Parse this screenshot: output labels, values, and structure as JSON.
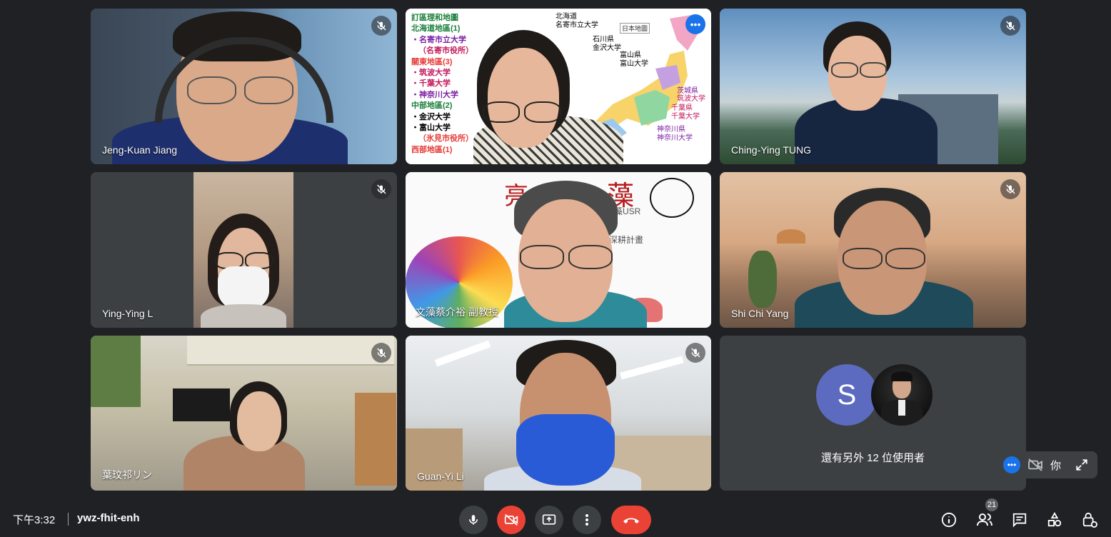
{
  "participants": [
    {
      "name": "Jeng-Kuan Jiang"
    },
    {
      "name": "Ching-Ying TUNG"
    },
    {
      "name": "Ying-Ying L"
    },
    {
      "name": "Shi Chi Yang"
    },
    {
      "name": "葉玟祁リン"
    },
    {
      "name": "Guan-Yi Li"
    }
  ],
  "map_slide": {
    "title": "訂區理和地圖",
    "lines": [
      "北海道地區(1)",
      "・名寄市立大学",
      "（名寄市役所）",
      "關東地區(3)",
      "・筑波大学",
      "・千葉大学",
      "・神奈川大学",
      "中部地區(2)",
      "・金沢大学",
      "・富山大学",
      "（氷見市役所）",
      "西部地區(1)"
    ],
    "map_labels": [
      "北海道",
      "名寄市立大学",
      "石川県",
      "金沢大学",
      "富山県",
      "富山大学",
      "茨城県",
      "筑波大学",
      "千葉県",
      "千葉大学",
      "神奈川県",
      "神奈川大学"
    ],
    "legend": "日本地圖"
  },
  "usr_slide": {
    "char_a": "藻",
    "char_b": "亮",
    "subtitle": "文藻USR",
    "subtitle_b": "深耕計畫",
    "caption": "文藻蔡介裕 副教授"
  },
  "others": {
    "avatar_letter": "S",
    "text": "還有另外 12 位使用者"
  },
  "self_view": {
    "label": "你"
  },
  "bottom": {
    "time": "下午3:32",
    "code": "ywz-fhit-enh",
    "people_count": "21"
  },
  "colors": {
    "accent": "#1a73e8",
    "danger": "#ea4335",
    "bg": "#202124",
    "tile": "#3c4043"
  }
}
